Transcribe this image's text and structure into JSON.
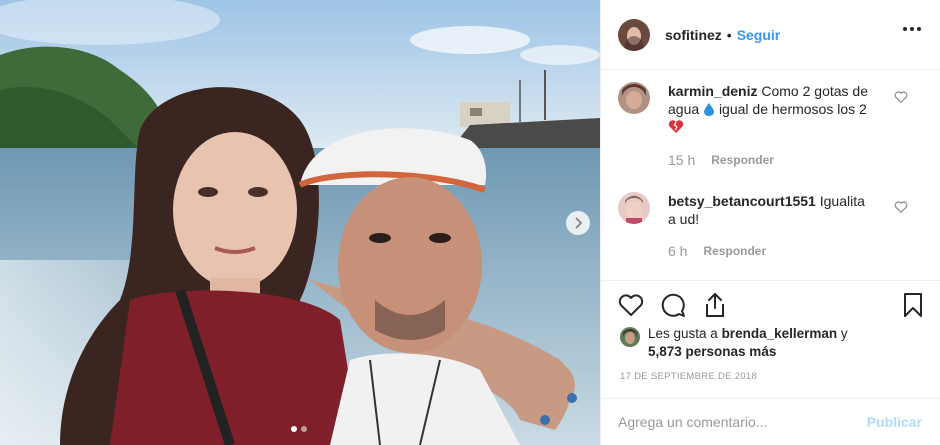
{
  "post": {
    "author": "sofitinez",
    "separator": "•",
    "follow_label": "Seguir",
    "more_icon": "more-horizontal-icon",
    "carousel": {
      "current": 1,
      "total": 2
    }
  },
  "comments": [
    {
      "username": "karmin_deniz",
      "text_before_emoji": " Como 2 gotas de agua ",
      "text_after_emoji": "igual de hermosos los 2",
      "emojis": [
        "droplet-emoji",
        "broken-heart-emoji"
      ],
      "time": "15 h",
      "reply_label": "Responder"
    },
    {
      "username": "betsy_betancourt1551",
      "text": " Igualita a ud!",
      "time": "6 h",
      "reply_label": "Responder"
    }
  ],
  "likes": {
    "prefix": "Les gusta a ",
    "user": "brenda_kellerman",
    "middle": " y ",
    "others": "5,873 personas más"
  },
  "date": "17 de septiembre de 2018",
  "add_comment": {
    "placeholder": "Agrega un comentario...",
    "publish_label": "Publicar"
  },
  "colors": {
    "link_blue": "#3897f0",
    "publish_disabled": "#b3dbff",
    "muted_text": "#999999",
    "divider": "#efefef"
  }
}
